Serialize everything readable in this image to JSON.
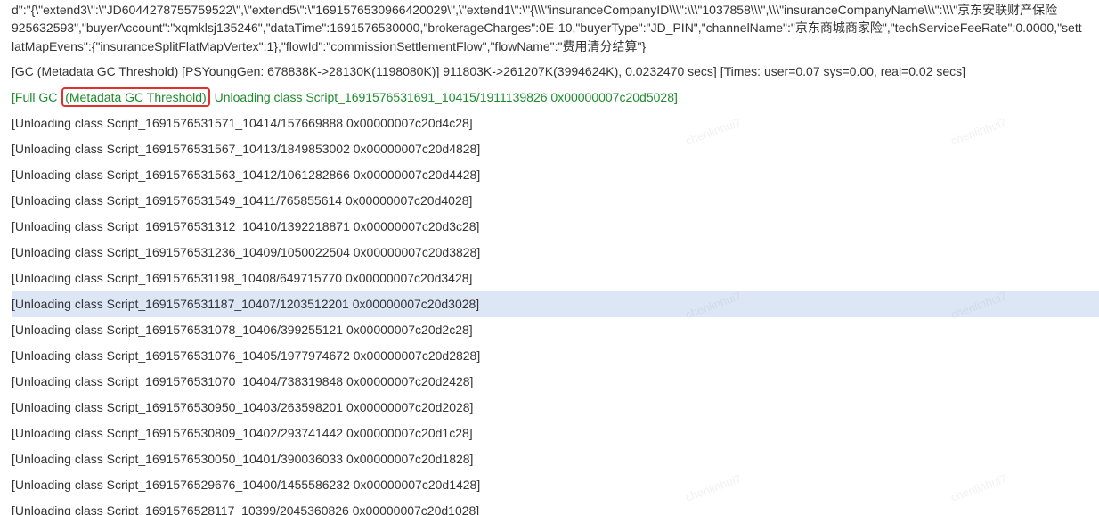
{
  "json_lines": [
    "d\":\"{\\\"extend3\\\":\\\"JD6044278755759522\\\",\\\"extend5\\\":\\\"1691576530966420029\\\",\\\"extend1\\\":\\\"{\\\\\\\"insuranceCompanyID\\\\\\\":\\\\\\\"1037858\\\\\\\",\\\\\\\"insuranceCompanyName\\\\\\\":\\\\\\\"京东安联财产保险",
    "925632593\",\"buyerAccount\":\"xqmklsj135246\",\"dataTime\":1691576530000,\"brokerageCharges\":0E-10,\"buyerType\":\"JD_PIN\",\"channelName\":\"京东商城商家险\",\"techServiceFeeRate\":0.0000,\"sett",
    "latMapEvens\":{\"insuranceSplitFlatMapVertex\":1},\"flowId\":\"commissionSettlementFlow\",\"flowName\":\"费用清分结算\"}"
  ],
  "gc_line": "[GC (Metadata GC Threshold) [PSYoungGen: 678838K->28130K(1198080K)] 911803K->261207K(3994624K), 0.0232470 secs] [Times: user=0.07 sys=0.00, real=0.02 secs]",
  "full_gc": {
    "prefix": "[Full GC ",
    "highlight": "(Metadata GC Threshold)",
    "suffix": " Unloading class Script_1691576531691_10415/1911139826 0x00000007c20d5028]"
  },
  "unload_lines": [
    "[Unloading class Script_1691576531571_10414/157669888 0x00000007c20d4c28]",
    "[Unloading class Script_1691576531567_10413/1849853002 0x00000007c20d4828]",
    "[Unloading class Script_1691576531563_10412/1061282866 0x00000007c20d4428]",
    "[Unloading class Script_1691576531549_10411/765855614 0x00000007c20d4028]",
    "[Unloading class Script_1691576531312_10410/1392218871 0x00000007c20d3c28]",
    "[Unloading class Script_1691576531236_10409/1050022504 0x00000007c20d3828]",
    "[Unloading class Script_1691576531198_10408/649715770 0x00000007c20d3428]",
    "[Unloading class Script_1691576531187_10407/1203512201 0x00000007c20d3028]",
    "[Unloading class Script_1691576531078_10406/399255121 0x00000007c20d2c28]",
    "[Unloading class Script_1691576531076_10405/1977974672 0x00000007c20d2828]",
    "[Unloading class Script_1691576531070_10404/738319848 0x00000007c20d2428]",
    "[Unloading class Script_1691576530950_10403/263598201 0x00000007c20d2028]",
    "[Unloading class Script_1691576530809_10402/293741442 0x00000007c20d1c28]",
    "[Unloading class Script_1691576530050_10401/390036033 0x00000007c20d1828]",
    "[Unloading class Script_1691576529676_10400/1455586232 0x00000007c20d1428]",
    "[Unloading class Script_1691576528117_10399/2045360826 0x00000007c20d1028]"
  ],
  "selected_line_index": 7,
  "watermark_text": "chenlinhui7",
  "colors": {
    "text": "#333333",
    "full_gc": "#1c8b2b",
    "highlight_border": "#e0312f",
    "selected_bg": "#dde6f5"
  }
}
